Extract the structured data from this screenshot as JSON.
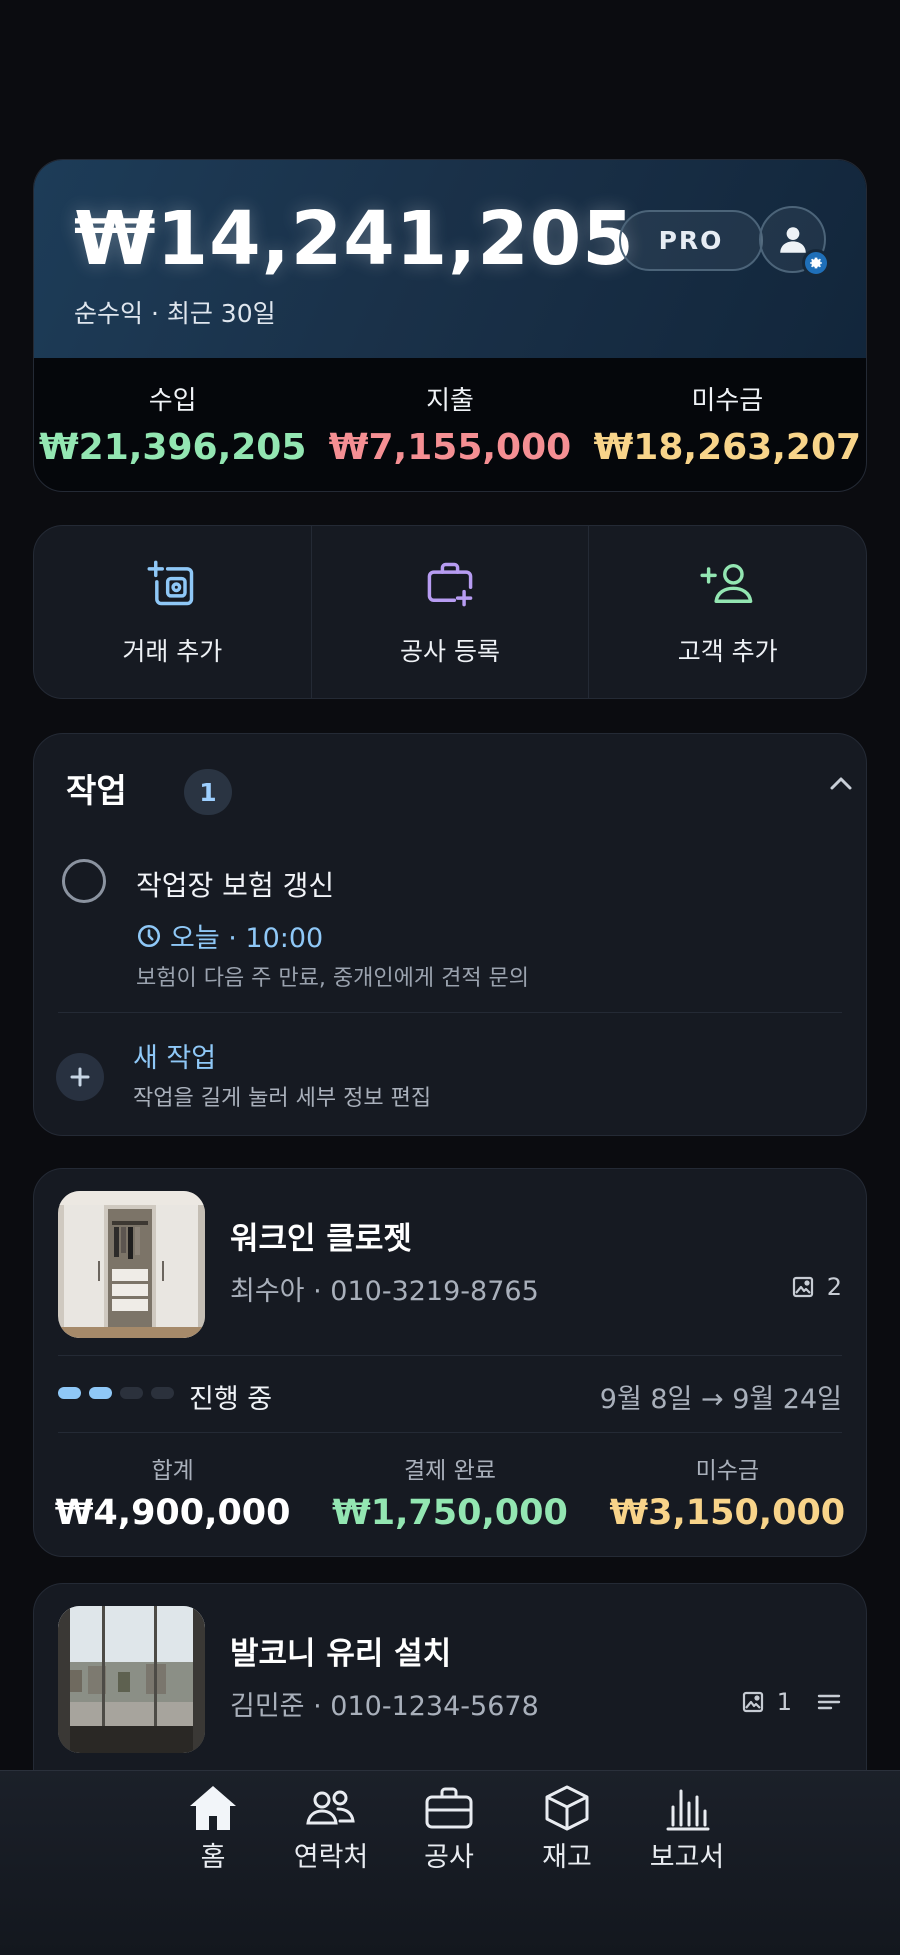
{
  "summary": {
    "net_amount": "₩14,241,205",
    "net_label": "순수익 · 최근 30일",
    "badge": "PRO",
    "stats": [
      {
        "label": "수입",
        "value": "₩21,396,205",
        "color": "#93e6b2"
      },
      {
        "label": "지출",
        "value": "₩7,155,000",
        "color": "#f58f93"
      },
      {
        "label": "미수금",
        "value": "₩18,263,207",
        "color": "#f8d48a"
      }
    ]
  },
  "quick_actions": [
    {
      "label": "거래 추가",
      "icon": "add-transaction-icon",
      "color": "#8fc8f7"
    },
    {
      "label": "공사 등록",
      "icon": "add-project-briefcase-icon",
      "color": "#b79cf2"
    },
    {
      "label": "고객 추가",
      "icon": "add-user-icon",
      "color": "#93e6b2"
    }
  ],
  "tasks": {
    "title": "작업",
    "count": "1",
    "items": [
      {
        "title": "작업장 보험 갱신",
        "time": "오늘 · 10:00",
        "description": "보험이 다음 주 만료, 중개인에게 견적 문의"
      }
    ],
    "new_task": {
      "title": "새 작업",
      "hint": "작업을 길게 눌러 세부 정보 편집"
    }
  },
  "jobs": [
    {
      "name": "워크인 클로젯",
      "contact_name": "최수아",
      "phone": "010-3219-8765",
      "photo_count": "2",
      "status": "진행 중",
      "progress_steps_done": 2,
      "progress_steps_total": 4,
      "dates": "9월 8일 → 9월 24일",
      "money": [
        {
          "label": "합계",
          "value": "₩4,900,000",
          "color": "#ffffff"
        },
        {
          "label": "결제 완료",
          "value": "₩1,750,000",
          "color": "#93e6b2"
        },
        {
          "label": "미수금",
          "value": "₩3,150,000",
          "color": "#f8d48a"
        }
      ]
    },
    {
      "name": "발코니 유리 설치",
      "contact_name": "김민준",
      "phone": "010-1234-5678",
      "photo_count": "1"
    }
  ],
  "nav": [
    {
      "label": "홈",
      "icon": "home-icon",
      "active": true
    },
    {
      "label": "연락처",
      "icon": "contacts-icon"
    },
    {
      "label": "공사",
      "icon": "briefcase-icon"
    },
    {
      "label": "재고",
      "icon": "box-icon"
    },
    {
      "label": "보고서",
      "icon": "bar-chart-icon"
    }
  ]
}
